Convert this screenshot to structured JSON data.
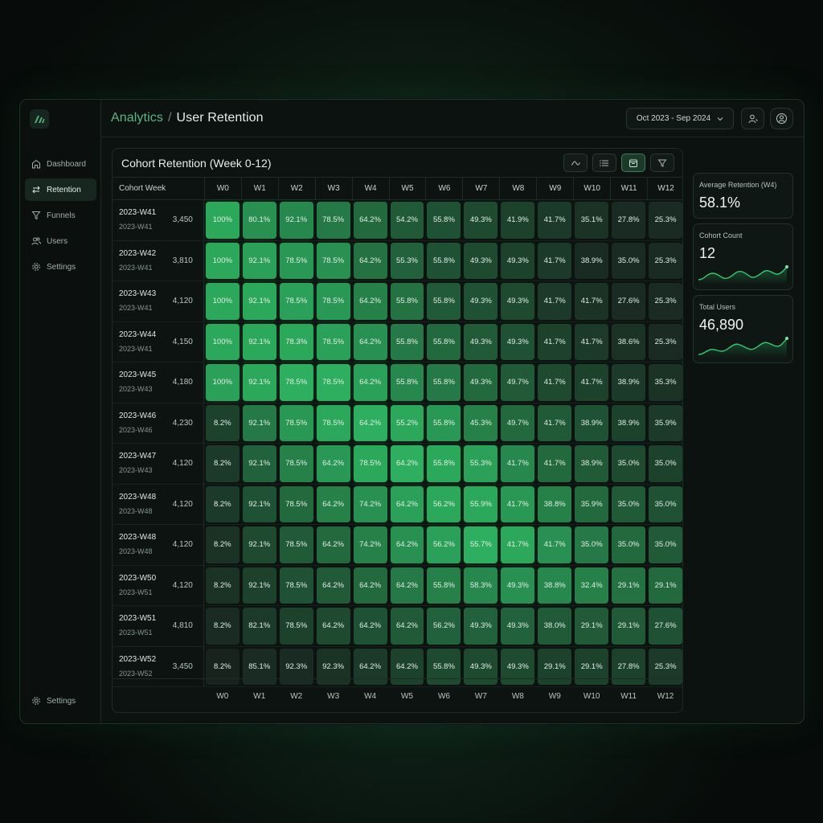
{
  "breadcrumb": {
    "parent": "Analytics",
    "separator": "/",
    "current": "User Retention"
  },
  "date_range": "Oct 2023 - Sep 2024",
  "sidebar": {
    "items": [
      {
        "label": "Dashboard",
        "icon": "dashboard-icon"
      },
      {
        "label": "Retention",
        "icon": "retention-icon",
        "active": true
      },
      {
        "label": "Funnels",
        "icon": "funnel-icon"
      },
      {
        "label": "Users",
        "icon": "users-icon"
      },
      {
        "label": "Settings",
        "icon": "gear-icon"
      }
    ],
    "bottom_item": {
      "label": "Settings",
      "icon": "gear-icon"
    }
  },
  "panel": {
    "title": "Cohort Retention (Week 0-12)",
    "first_column_header": "Cohort Week",
    "tools": [
      "trend-icon",
      "list-icon",
      "calendar-icon",
      "filter-icon"
    ]
  },
  "weeks": [
    "W0",
    "W1",
    "W2",
    "W3",
    "W4",
    "W5",
    "W6",
    "W7",
    "W8",
    "W9",
    "W10",
    "W11",
    "W12"
  ],
  "cohorts": [
    {
      "name": "2023-W41",
      "sub": "2023-W41",
      "size": "3,450",
      "values": [
        "100%",
        "80.1%",
        "92.1%",
        "78.5%",
        "64.2%",
        "54.2%",
        "55.8%",
        "49.3%",
        "41.9%",
        "41.7%",
        "35.1%",
        "27.8%",
        "25.3%"
      ],
      "levels": [
        0.85,
        0.7,
        0.65,
        0.55,
        0.45,
        0.35,
        0.3,
        0.25,
        0.2,
        0.15,
        0.1,
        0.05,
        0.05
      ]
    },
    {
      "name": "2023-W42",
      "sub": "2023-W41",
      "size": "3,810",
      "values": [
        "100%",
        "92.1%",
        "78.5%",
        "78.5%",
        "64.2%",
        "55.3%",
        "55.8%",
        "49.3%",
        "49.3%",
        "41.7%",
        "38.9%",
        "35.0%",
        "25.3%"
      ],
      "levels": [
        0.85,
        0.8,
        0.75,
        0.7,
        0.5,
        0.4,
        0.3,
        0.25,
        0.2,
        0.15,
        0.05,
        0.05,
        0.05
      ]
    },
    {
      "name": "2023-W43",
      "sub": "2023-W41",
      "size": "4,120",
      "values": [
        "100%",
        "92.1%",
        "78.5%",
        "78.5%",
        "64.2%",
        "55.8%",
        "55.8%",
        "49.3%",
        "49.3%",
        "41.7%",
        "41.7%",
        "27.6%",
        "25.3%"
      ],
      "levels": [
        0.85,
        0.85,
        0.8,
        0.75,
        0.6,
        0.5,
        0.35,
        0.3,
        0.25,
        0.15,
        0.1,
        0.05,
        0.05
      ]
    },
    {
      "name": "2023-W44",
      "sub": "2023-W41",
      "size": "4,150",
      "values": [
        "100%",
        "92.1%",
        "78.3%",
        "78.5%",
        "64.2%",
        "55.8%",
        "55.8%",
        "49.3%",
        "49.3%",
        "41.7%",
        "41.7%",
        "38.6%",
        "25.3%"
      ],
      "levels": [
        0.85,
        0.85,
        0.85,
        0.8,
        0.7,
        0.55,
        0.45,
        0.35,
        0.3,
        0.2,
        0.15,
        0.1,
        0.05
      ]
    },
    {
      "name": "2023-W45",
      "sub": "2023-W43",
      "size": "4,180",
      "values": [
        "100%",
        "92.1%",
        "78.5%",
        "78.5%",
        "64.2%",
        "55.8%",
        "55.8%",
        "49.3%",
        "49.7%",
        "41.7%",
        "41.7%",
        "38.9%",
        "35.3%"
      ],
      "levels": [
        0.8,
        0.85,
        0.9,
        0.9,
        0.8,
        0.65,
        0.55,
        0.45,
        0.35,
        0.25,
        0.2,
        0.15,
        0.1
      ]
    },
    {
      "name": "2023-W46",
      "sub": "2023-W46",
      "size": "4,230",
      "values": [
        "8.2%",
        "92.1%",
        "78.5%",
        "78.5%",
        "64.2%",
        "55.2%",
        "55.8%",
        "45.3%",
        "49.7%",
        "41.7%",
        "38.9%",
        "38.9%",
        "35.9%"
      ],
      "levels": [
        0.2,
        0.55,
        0.75,
        0.85,
        0.9,
        0.85,
        0.75,
        0.6,
        0.45,
        0.35,
        0.3,
        0.2,
        0.15
      ]
    },
    {
      "name": "2023-W47",
      "sub": "2023-W43",
      "size": "4,120",
      "values": [
        "8.2%",
        "92.1%",
        "78.5%",
        "64.2%",
        "78.5%",
        "64.2%",
        "55.8%",
        "55.3%",
        "41.7%",
        "41.7%",
        "38.9%",
        "35.0%",
        "35.0%"
      ],
      "levels": [
        0.15,
        0.4,
        0.6,
        0.75,
        0.85,
        0.9,
        0.85,
        0.8,
        0.65,
        0.45,
        0.35,
        0.25,
        0.2
      ]
    },
    {
      "name": "2023-W48",
      "sub": "2023-W48",
      "size": "4,120",
      "values": [
        "8.2%",
        "92.1%",
        "78.5%",
        "64.2%",
        "74.2%",
        "64.2%",
        "56.2%",
        "55.9%",
        "41.7%",
        "38.8%",
        "35.9%",
        "35.0%",
        "35.0%"
      ],
      "levels": [
        0.15,
        0.3,
        0.45,
        0.6,
        0.7,
        0.8,
        0.85,
        0.85,
        0.75,
        0.6,
        0.45,
        0.35,
        0.3
      ]
    },
    {
      "name": "2023-W48",
      "sub": "2023-W48",
      "size": "4,120",
      "values": [
        "8.2%",
        "92.1%",
        "78.5%",
        "64.2%",
        "74.2%",
        "64.2%",
        "56.2%",
        "55.7%",
        "41.7%",
        "41.7%",
        "35.0%",
        "35.0%",
        "35.0%"
      ],
      "levels": [
        0.1,
        0.25,
        0.35,
        0.45,
        0.6,
        0.7,
        0.8,
        0.9,
        0.85,
        0.7,
        0.55,
        0.45,
        0.35
      ]
    },
    {
      "name": "2023-W50",
      "sub": "2023-W51",
      "size": "4,120",
      "values": [
        "8.2%",
        "92.1%",
        "78.5%",
        "64.2%",
        "64.2%",
        "64.2%",
        "55.8%",
        "58.3%",
        "49.3%",
        "38.8%",
        "32.4%",
        "29.1%",
        "29.1%"
      ],
      "levels": [
        0.1,
        0.2,
        0.3,
        0.35,
        0.45,
        0.55,
        0.6,
        0.65,
        0.7,
        0.65,
        0.6,
        0.5,
        0.45
      ]
    },
    {
      "name": "2023-W51",
      "sub": "2023-W51",
      "size": "4,810",
      "values": [
        "8.2%",
        "82.1%",
        "78.5%",
        "64.2%",
        "64.2%",
        "64.2%",
        "56.2%",
        "49.3%",
        "49.3%",
        "38.0%",
        "29.1%",
        "29.1%",
        "27.6%"
      ],
      "levels": [
        0.05,
        0.15,
        0.2,
        0.25,
        0.3,
        0.35,
        0.4,
        0.4,
        0.4,
        0.35,
        0.35,
        0.35,
        0.3
      ]
    },
    {
      "name": "2023-W52",
      "sub": "2023-W52",
      "size": "3,450",
      "values": [
        "8.2%",
        "85.1%",
        "92.3%",
        "92.3%",
        "64.2%",
        "64.2%",
        "55.8%",
        "49.3%",
        "49.3%",
        "29.1%",
        "29.1%",
        "27.8%",
        "25.3%"
      ],
      "levels": [
        0.0,
        0.05,
        0.05,
        0.1,
        0.15,
        0.2,
        0.25,
        0.25,
        0.25,
        0.2,
        0.2,
        0.2,
        0.15
      ]
    }
  ],
  "metrics": [
    {
      "label": "Average Retention (W4)",
      "value": "58.1%"
    },
    {
      "label": "Cohort Count",
      "value": "12"
    },
    {
      "label": "Total Users",
      "value": "46,890"
    }
  ],
  "colors": {
    "accent": "#5fb583",
    "cell_low": "#18231e",
    "cell_high": "#2fbf66"
  }
}
